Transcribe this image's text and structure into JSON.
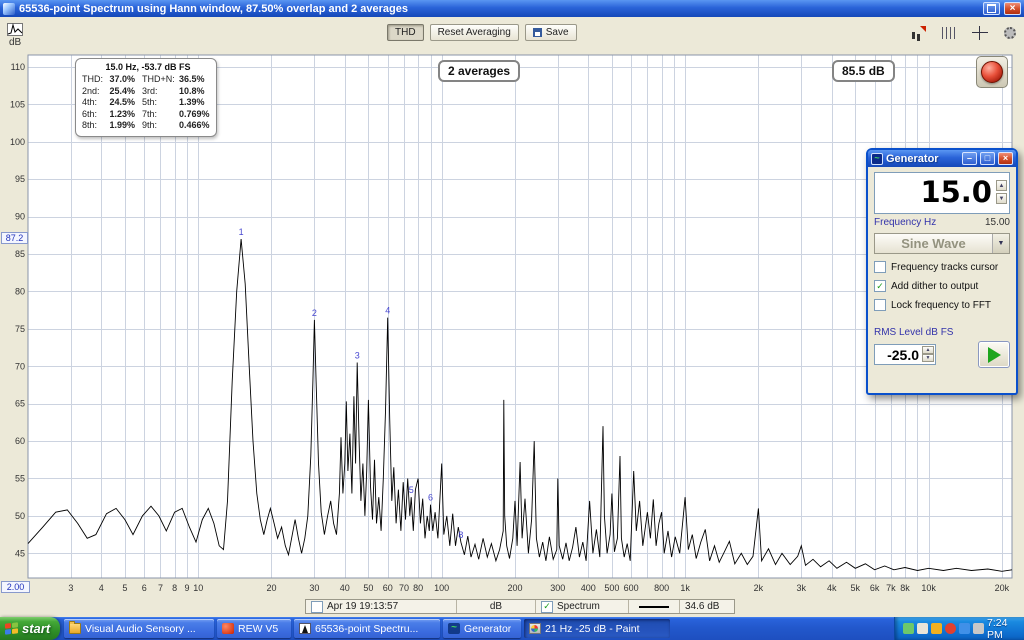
{
  "window": {
    "title": "65536-point Spectrum using Hann window, 87.50% overlap and 2 averages"
  },
  "toolbar": {
    "thd_label": "THD",
    "reset_label": "Reset Averaging",
    "save_label": "Save",
    "icons": [
      "measure-icon",
      "gridlines-icon",
      "crosshair-icon",
      "settings-gear-icon"
    ]
  },
  "chart": {
    "averages_badge": "2 averages",
    "headroom_badge": "85.5 dB",
    "y_cursor": "87.2",
    "x_cursor": "2.00"
  },
  "info_box": {
    "header": "15.0 Hz, -53.7 dB FS",
    "rows": [
      {
        "l1": "THD:",
        "v1": "37.0%",
        "l2": "THD+N:",
        "v2": "36.5%"
      },
      {
        "l1": "2nd:",
        "v1": "25.4%",
        "l2": "3rd:",
        "v2": "10.8%"
      },
      {
        "l1": "4th:",
        "v1": "24.5%",
        "l2": "5th:",
        "v2": "1.39%"
      },
      {
        "l1": "6th:",
        "v1": "1.23%",
        "l2": "7th:",
        "v2": "0.769%"
      },
      {
        "l1": "8th:",
        "v1": "1.99%",
        "l2": "9th:",
        "v2": "0.466%"
      }
    ]
  },
  "generator": {
    "title": "Generator",
    "frequency_display": "15.0",
    "frequency_label": "Frequency Hz",
    "frequency_value": "15.00",
    "waveform": "Sine Wave",
    "checkboxes": [
      {
        "label": "Frequency tracks cursor",
        "checked": false
      },
      {
        "label": "Add dither to output",
        "checked": true
      },
      {
        "label": "Lock frequency to FFT",
        "checked": false
      }
    ],
    "rms_label": "RMS Level dB FS",
    "rms_value": "-25.0"
  },
  "statusbar": {
    "timestamp": "Apr 19 19:13:57",
    "db_field": "dB",
    "trace_label": "Spectrum",
    "level_value": "34.6 dB"
  },
  "taskbar": {
    "start_label": "start",
    "tasks": [
      {
        "label": "Visual Audio Sensory ...",
        "icon": "folder-icon",
        "active": false,
        "width": 150
      },
      {
        "label": "REW V5",
        "icon": "rew-app-icon",
        "active": false,
        "width": 74
      },
      {
        "label": "65536-point Spectru...",
        "icon": "spectrum-window-icon",
        "active": false,
        "width": 146
      },
      {
        "label": "Generator",
        "icon": "generator-window-icon",
        "active": false,
        "width": 78
      },
      {
        "label": "21 Hz -25 dB - Paint",
        "icon": "paint-app-icon",
        "active": true,
        "width": 146
      }
    ],
    "tray_icons": [
      "tray-messenger-icon",
      "tray-volume-icon",
      "tray-shield-icon",
      "tray-antivirus-icon",
      "tray-network-icon",
      "tray-usb-icon"
    ],
    "clock": "7:24 PM"
  },
  "chart_data": {
    "type": "line",
    "x_scale": "log",
    "xlim": [
      2,
      22000
    ],
    "ylim": [
      41.7,
      111.6
    ],
    "xlabel": "",
    "ylabel": "dB",
    "grid": true,
    "y_ticks": [
      45,
      50,
      55,
      60,
      65,
      70,
      75,
      80,
      85,
      90,
      95,
      100,
      105,
      110
    ],
    "x_tick_labels": [
      [
        3,
        "3"
      ],
      [
        4,
        "4"
      ],
      [
        5,
        "5"
      ],
      [
        6,
        "6"
      ],
      [
        7,
        "7"
      ],
      [
        8,
        "8"
      ],
      [
        9,
        "9"
      ],
      [
        10,
        "10"
      ],
      [
        20,
        "20"
      ],
      [
        30,
        "30"
      ],
      [
        40,
        "40"
      ],
      [
        50,
        "50"
      ],
      [
        60,
        "60"
      ],
      [
        70,
        "70"
      ],
      [
        80,
        "80"
      ],
      [
        100,
        "100"
      ],
      [
        200,
        "200"
      ],
      [
        300,
        "300"
      ],
      [
        400,
        "400"
      ],
      [
        500,
        "500"
      ],
      [
        600,
        "600"
      ],
      [
        800,
        "800"
      ],
      [
        1000,
        "1k"
      ],
      [
        2000,
        "2k"
      ],
      [
        3000,
        "3k"
      ],
      [
        4000,
        "4k"
      ],
      [
        5000,
        "5k"
      ],
      [
        6000,
        "6k"
      ],
      [
        7000,
        "7k"
      ],
      [
        8000,
        "8k"
      ],
      [
        10000,
        "10k"
      ],
      [
        20000,
        "20k"
      ]
    ],
    "harmonic_markers": [
      [
        15,
        87.0,
        "1"
      ],
      [
        30,
        76.2,
        "2"
      ],
      [
        45,
        70.5,
        "3"
      ],
      [
        60,
        76.5,
        "4"
      ],
      [
        75,
        52.5,
        "5"
      ],
      [
        90,
        51.5,
        "6"
      ],
      [
        120,
        46.5,
        "8"
      ]
    ],
    "series": [
      {
        "name": "Spectrum",
        "color": "#000000",
        "points": [
          [
            2,
            46.3
          ],
          [
            2.3,
            48.5
          ],
          [
            2.6,
            50.5
          ],
          [
            2.9,
            50.8
          ],
          [
            3.2,
            49
          ],
          [
            3.5,
            47
          ],
          [
            3.8,
            47.5
          ],
          [
            4.2,
            50.3
          ],
          [
            4.6,
            51
          ],
          [
            5,
            49.5
          ],
          [
            5.4,
            47.5
          ],
          [
            5.9,
            50
          ],
          [
            6.4,
            51.3
          ],
          [
            6.9,
            50
          ],
          [
            7.4,
            48
          ],
          [
            8,
            50.5
          ],
          [
            8.6,
            51
          ],
          [
            9.2,
            48.5
          ],
          [
            9.8,
            46.5
          ],
          [
            10.4,
            49.5
          ],
          [
            11,
            51
          ],
          [
            11.6,
            49
          ],
          [
            12.2,
            46
          ],
          [
            12.7,
            45.5
          ],
          [
            13.2,
            52
          ],
          [
            13.8,
            68
          ],
          [
            14.4,
            80
          ],
          [
            15,
            87
          ],
          [
            15.6,
            81
          ],
          [
            16.2,
            70
          ],
          [
            16.8,
            60
          ],
          [
            17.4,
            53
          ],
          [
            18,
            49.5
          ],
          [
            18.6,
            47.5
          ],
          [
            19.2,
            49.5
          ],
          [
            19.8,
            51
          ],
          [
            20.5,
            49
          ],
          [
            21.2,
            47
          ],
          [
            22,
            48.5
          ],
          [
            22.8,
            46
          ],
          [
            23.5,
            44.8
          ],
          [
            24.2,
            47
          ],
          [
            25,
            49.5
          ],
          [
            25.8,
            47
          ],
          [
            26.6,
            45
          ],
          [
            27.4,
            47
          ],
          [
            28.2,
            50
          ],
          [
            29,
            58
          ],
          [
            29.6,
            68
          ],
          [
            30,
            76.2
          ],
          [
            30.5,
            68
          ],
          [
            31.2,
            57
          ],
          [
            32,
            50.5
          ],
          [
            33,
            47.5
          ],
          [
            34,
            50
          ],
          [
            35,
            52
          ],
          [
            36,
            49
          ],
          [
            37,
            47.5
          ],
          [
            38,
            53
          ],
          [
            38.6,
            60.5
          ],
          [
            39.3,
            53
          ],
          [
            40,
            57
          ],
          [
            40.6,
            65.3
          ],
          [
            41.2,
            56
          ],
          [
            42,
            61
          ],
          [
            42.8,
            53
          ],
          [
            43.6,
            66
          ],
          [
            44.3,
            57
          ],
          [
            45,
            70.5
          ],
          [
            45.8,
            60
          ],
          [
            46.6,
            52
          ],
          [
            47.5,
            57
          ],
          [
            48.4,
            50
          ],
          [
            49.2,
            56
          ],
          [
            50,
            65.5
          ],
          [
            51,
            54
          ],
          [
            52,
            49.5
          ],
          [
            53,
            57.5
          ],
          [
            54,
            49
          ],
          [
            55.2,
            52.5
          ],
          [
            56.4,
            48
          ],
          [
            57.6,
            55
          ],
          [
            58.8,
            64
          ],
          [
            60,
            76.5
          ],
          [
            61.2,
            63
          ],
          [
            62.4,
            52
          ],
          [
            63.6,
            56.5
          ],
          [
            65,
            49
          ],
          [
            66.4,
            53.5
          ],
          [
            68,
            48
          ],
          [
            69.5,
            54.5
          ],
          [
            71,
            49.5
          ],
          [
            72.5,
            55
          ],
          [
            74,
            50
          ],
          [
            75,
            52.5
          ],
          [
            76.5,
            48
          ],
          [
            78,
            53.5
          ],
          [
            80,
            55
          ],
          [
            81.8,
            49
          ],
          [
            83.6,
            52.3
          ],
          [
            85.4,
            47
          ],
          [
            87.2,
            50
          ],
          [
            89,
            48
          ],
          [
            90,
            51.5
          ],
          [
            92,
            48
          ],
          [
            94,
            50.5
          ],
          [
            96.5,
            47
          ],
          [
            100,
            57
          ],
          [
            102,
            47.5
          ],
          [
            105,
            50
          ],
          [
            108,
            46
          ],
          [
            111,
            50.3
          ],
          [
            114,
            46
          ],
          [
            117,
            48.5
          ],
          [
            120,
            46.5
          ],
          [
            124,
            44.8
          ],
          [
            128,
            47.3
          ],
          [
            132,
            44.5
          ],
          [
            137,
            46.2
          ],
          [
            142,
            44.2
          ],
          [
            148,
            47
          ],
          [
            154,
            44.5
          ],
          [
            160,
            46.3
          ],
          [
            167,
            44
          ],
          [
            173,
            45.5
          ],
          [
            179,
            48
          ],
          [
            180,
            65.5
          ],
          [
            181.5,
            50
          ],
          [
            185,
            46
          ],
          [
            190,
            44.3
          ],
          [
            196,
            47
          ],
          [
            200,
            52
          ],
          [
            204,
            46
          ],
          [
            210,
            57.2
          ],
          [
            214,
            47
          ],
          [
            220,
            52.3
          ],
          [
            227,
            45
          ],
          [
            234,
            49.5
          ],
          [
            240,
            60
          ],
          [
            245,
            47
          ],
          [
            252,
            44.5
          ],
          [
            260,
            46.5
          ],
          [
            268,
            44
          ],
          [
            277,
            47.2
          ],
          [
            287,
            44.2
          ],
          [
            297,
            45.5
          ],
          [
            300,
            55
          ],
          [
            304,
            46
          ],
          [
            314,
            44.2
          ],
          [
            324,
            46.4
          ],
          [
            334,
            44
          ],
          [
            345,
            45.8
          ],
          [
            356,
            48.5
          ],
          [
            368,
            44.5
          ],
          [
            380,
            46.5
          ],
          [
            392,
            44
          ],
          [
            405,
            52
          ],
          [
            418,
            45
          ],
          [
            432,
            48.2
          ],
          [
            446,
            44.5
          ],
          [
            460,
            62
          ],
          [
            466,
            50
          ],
          [
            478,
            45
          ],
          [
            492,
            47.5
          ],
          [
            500,
            53
          ],
          [
            512,
            45.2
          ],
          [
            527,
            47
          ],
          [
            540,
            58
          ],
          [
            547,
            47
          ],
          [
            562,
            44.5
          ],
          [
            578,
            46.3
          ],
          [
            595,
            44
          ],
          [
            615,
            56
          ],
          [
            630,
            48
          ],
          [
            650,
            52
          ],
          [
            670,
            46
          ],
          [
            700,
            50.5
          ],
          [
            720,
            47
          ],
          [
            740,
            52.2
          ],
          [
            760,
            46
          ],
          [
            780,
            49
          ],
          [
            800,
            50.5
          ],
          [
            820,
            45
          ],
          [
            850,
            48
          ],
          [
            880,
            44.5
          ],
          [
            910,
            47.2
          ],
          [
            950,
            45
          ],
          [
            1000,
            52.5
          ],
          [
            1030,
            45.5
          ],
          [
            1070,
            47.5
          ],
          [
            1110,
            44.3
          ],
          [
            1160,
            46.5
          ],
          [
            1210,
            48.2
          ],
          [
            1260,
            44
          ],
          [
            1320,
            46
          ],
          [
            1380,
            43.8
          ],
          [
            1450,
            45.2
          ],
          [
            1520,
            46.6
          ],
          [
            1600,
            43.6
          ],
          [
            1700,
            45
          ],
          [
            1800,
            43.5
          ],
          [
            1900,
            44.6
          ],
          [
            2000,
            51
          ],
          [
            2060,
            44
          ],
          [
            2200,
            45.6
          ],
          [
            2350,
            43.5
          ],
          [
            2500,
            45
          ],
          [
            2700,
            43.5
          ],
          [
            2900,
            44.6
          ],
          [
            3000,
            46
          ],
          [
            3120,
            43.4
          ],
          [
            3350,
            44.2
          ],
          [
            3600,
            43.2
          ],
          [
            3900,
            44
          ],
          [
            4200,
            43
          ],
          [
            4600,
            43.8
          ],
          [
            5000,
            43
          ],
          [
            5500,
            43.6
          ],
          [
            6000,
            42.8
          ],
          [
            6600,
            43.3
          ],
          [
            7200,
            42.8
          ],
          [
            8000,
            43.1
          ],
          [
            9000,
            42.7
          ],
          [
            10000,
            43
          ],
          [
            11500,
            42.7
          ],
          [
            13000,
            43
          ],
          [
            15000,
            42.7
          ],
          [
            17500,
            42.9
          ],
          [
            20000,
            42.6
          ],
          [
            22000,
            42.8
          ]
        ]
      }
    ]
  }
}
